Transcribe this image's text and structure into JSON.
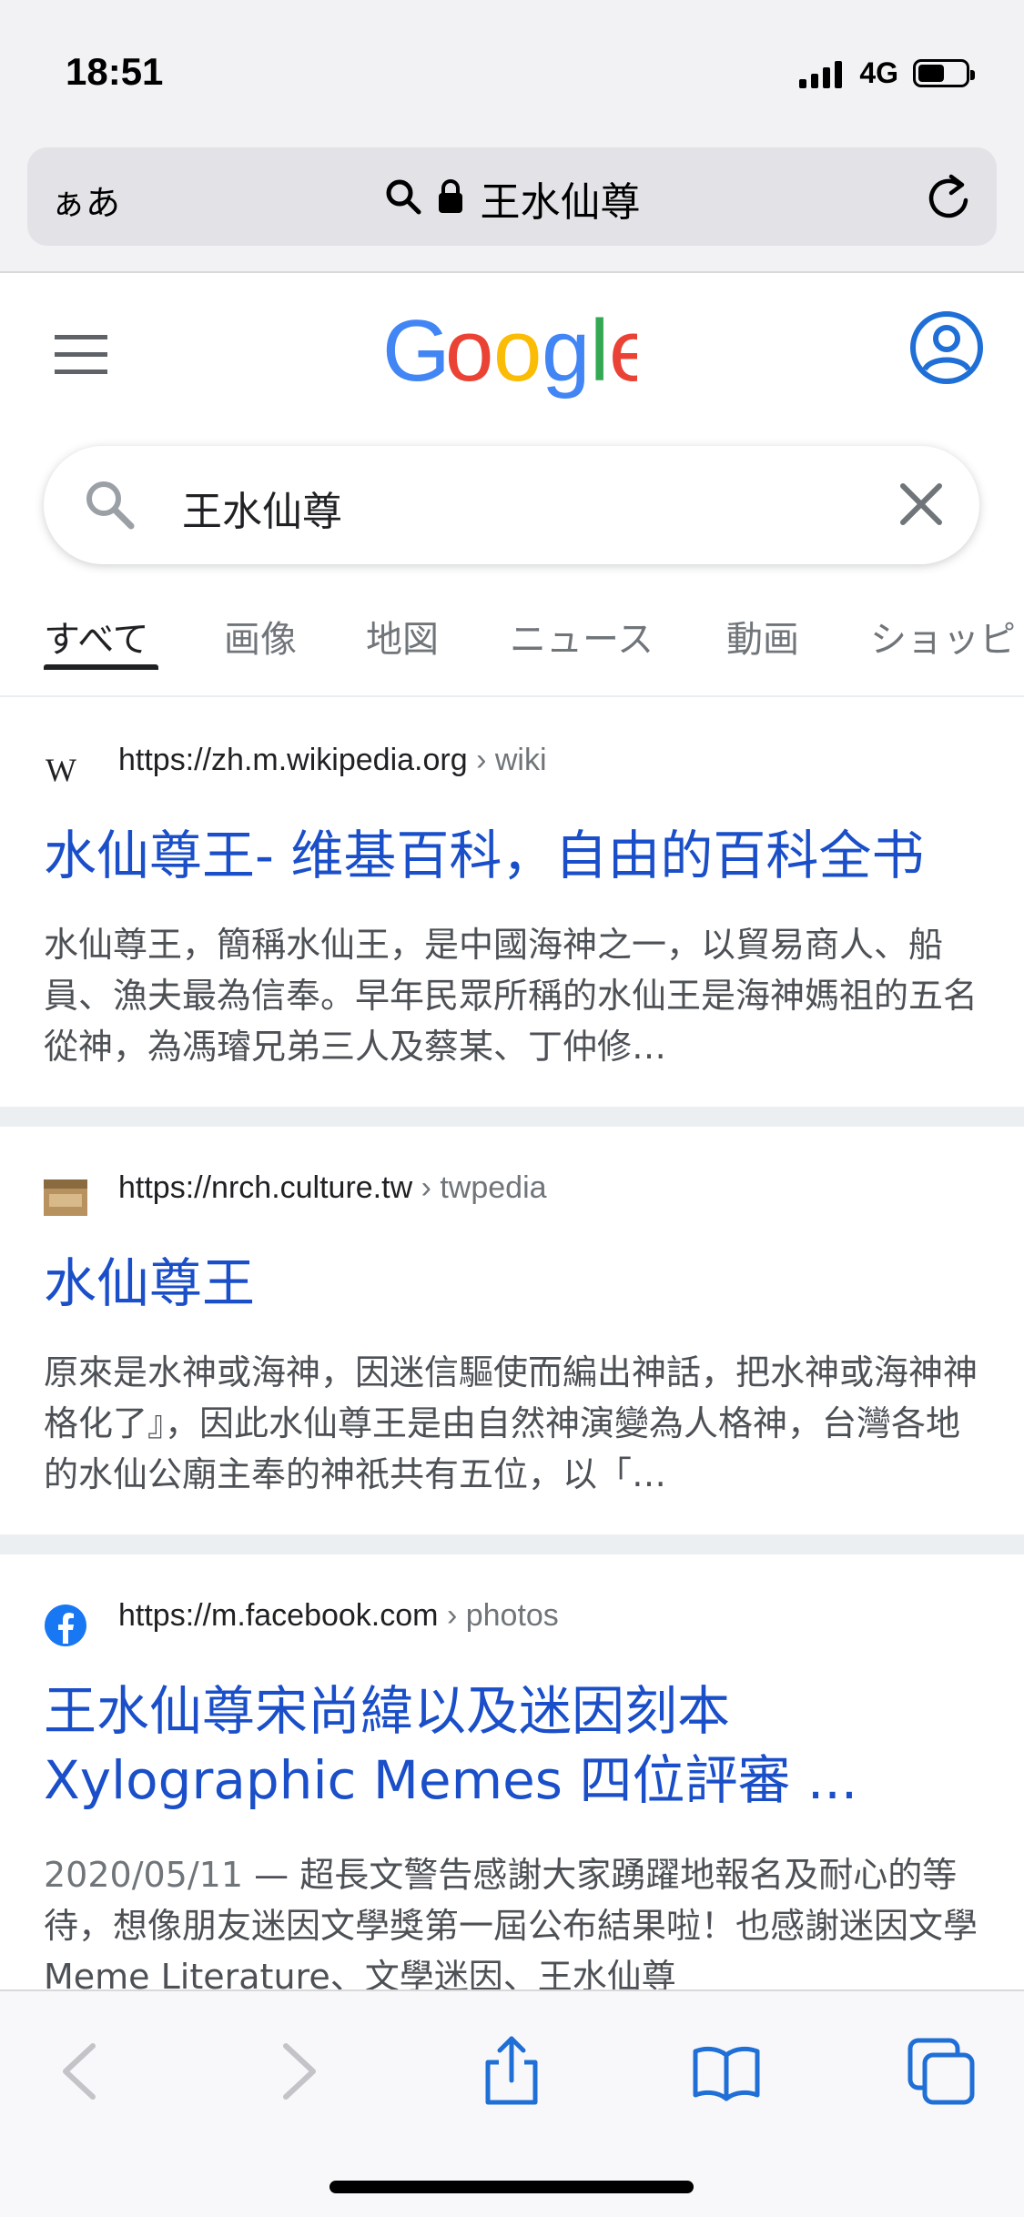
{
  "status": {
    "time": "18:51",
    "network": "4G",
    "battery_level": 0.55
  },
  "address_bar": {
    "aa_label": "ぁあ",
    "url_text": "王水仙尊",
    "icons": [
      "search-icon",
      "lock-icon",
      "reload-icon"
    ]
  },
  "google": {
    "logo_text": "Google",
    "menu_icon": "hamburger-menu-icon",
    "account_icon": "account-circle-icon"
  },
  "search": {
    "query": "王水仙尊"
  },
  "tabs": [
    {
      "label": "すべて",
      "active": true
    },
    {
      "label": "画像"
    },
    {
      "label": "地図"
    },
    {
      "label": "ニュース"
    },
    {
      "label": "動画"
    },
    {
      "label": "ショッピ"
    }
  ],
  "results": [
    {
      "favicon": "wikipedia-icon",
      "url": "https://zh.m.wikipedia.org",
      "crumb": " › wiki",
      "title": "水仙尊王- 维基百科，自由的百科全书",
      "snippet": "水仙尊王，簡稱水仙王，是中國海神之一，以貿易商人、船員、漁夫最為信奉。早年民眾所稱的水仙王是海神媽祖的五名從神，為馮璿兄弟三人及蔡某、丁仲修…"
    },
    {
      "favicon": "culture-site-icon",
      "url": "https://nrch.culture.tw",
      "crumb": " › twpedia",
      "title": "水仙尊王",
      "snippet": "原來是水神或海神，因迷信驅使而編出神話，把水神或海神神格化了』，因此水仙尊王是由自然神演變為人格神，台灣各地的水仙公廟主奉的神祇共有五位，以「…"
    },
    {
      "favicon": "facebook-icon",
      "url": "https://m.facebook.com",
      "crumb": " › photos",
      "title": "王水仙尊宋尚緯以及迷因刻本 Xylographic Memes 四位評審 ...",
      "date": "2020/05/11",
      "snippet": "超長文警告感謝大家踴躍地報名及耐心的等待，想像朋友迷因文學獎第一屆公布結果啦！也感謝迷因文學Meme Literature、文學迷因、王水仙尊"
    }
  ],
  "toolbar": {
    "buttons": [
      "back-icon",
      "forward-icon",
      "share-icon",
      "bookmarks-icon",
      "tabs-icon"
    ]
  },
  "colors": {
    "link": "#1a4fc9",
    "google_blue": "#4285F4",
    "google_red": "#EA4335",
    "google_yellow": "#FBBC05",
    "google_green": "#34A853",
    "ios_blue": "#1f6fd6"
  }
}
